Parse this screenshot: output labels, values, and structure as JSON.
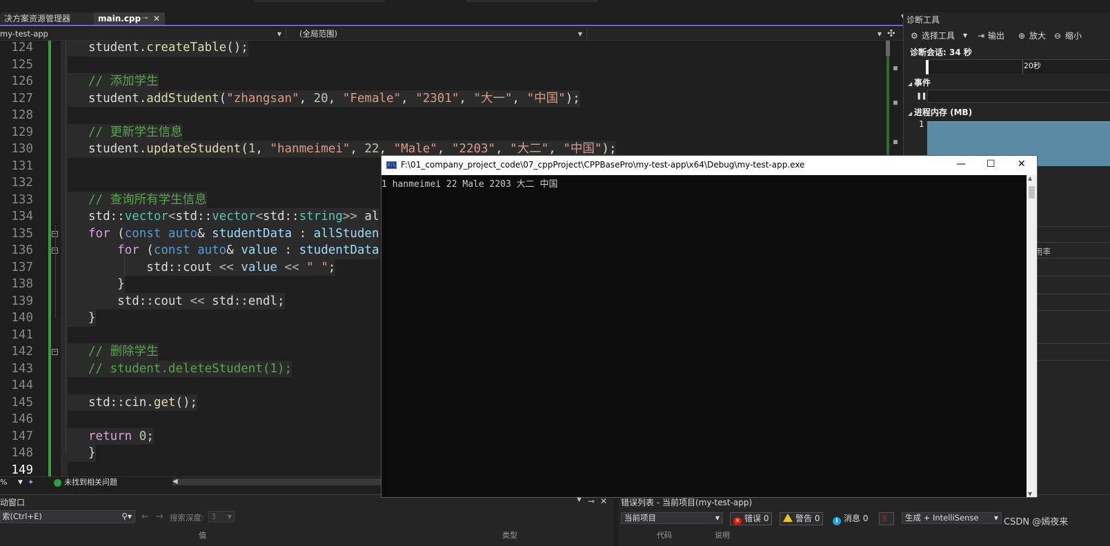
{
  "tabs": {
    "solution_explorer": "决方案资源管理器",
    "active_file": "main.cpp"
  },
  "nav": {
    "project": "my-test-app",
    "scope": "(全局范围)"
  },
  "editor": {
    "lines": [
      {
        "n": "124",
        "tokens": [
          [
            "c-id",
            "student."
          ],
          [
            "c-fn",
            "createTable"
          ],
          [
            "c-id",
            "();"
          ]
        ]
      },
      {
        "n": "125",
        "tokens": []
      },
      {
        "n": "126",
        "tokens": [
          [
            "c-cmt",
            "// 添加学生"
          ]
        ]
      },
      {
        "n": "127",
        "tokens": [
          [
            "c-id",
            "student."
          ],
          [
            "c-fn",
            "addStudent"
          ],
          [
            "c-id",
            "("
          ],
          [
            "c-str",
            "\"zhangsan\""
          ],
          [
            "c-id",
            ", "
          ],
          [
            "c-num",
            "20"
          ],
          [
            "c-id",
            ", "
          ],
          [
            "c-str",
            "\"Female\""
          ],
          [
            "c-id",
            ", "
          ],
          [
            "c-str",
            "\"2301\""
          ],
          [
            "c-id",
            ", "
          ],
          [
            "c-str",
            "\"大一\""
          ],
          [
            "c-id",
            ", "
          ],
          [
            "c-str",
            "\"中国\""
          ],
          [
            "c-id",
            ");"
          ]
        ]
      },
      {
        "n": "128",
        "tokens": []
      },
      {
        "n": "129",
        "tokens": [
          [
            "c-cmt",
            "// 更新学生信息"
          ]
        ]
      },
      {
        "n": "130",
        "tokens": [
          [
            "c-id",
            "student."
          ],
          [
            "c-fn",
            "updateStudent"
          ],
          [
            "c-id",
            "("
          ],
          [
            "c-num",
            "1"
          ],
          [
            "c-id",
            ", "
          ],
          [
            "c-str",
            "\"hanmeimei\""
          ],
          [
            "c-id",
            ", "
          ],
          [
            "c-num",
            "22"
          ],
          [
            "c-id",
            ", "
          ],
          [
            "c-str",
            "\"Male\""
          ],
          [
            "c-id",
            ", "
          ],
          [
            "c-str",
            "\"2203\""
          ],
          [
            "c-id",
            ", "
          ],
          [
            "c-str",
            "\"大二\""
          ],
          [
            "c-id",
            ", "
          ],
          [
            "c-str",
            "\"中国\""
          ],
          [
            "c-id",
            ");"
          ]
        ]
      },
      {
        "n": "131",
        "tokens": []
      },
      {
        "n": "132",
        "tokens": []
      },
      {
        "n": "133",
        "tokens": [
          [
            "c-cmt",
            "// 查询所有学生信息"
          ]
        ]
      },
      {
        "n": "134",
        "tokens": [
          [
            "c-id",
            "std::"
          ],
          [
            "c-ty",
            "vector"
          ],
          [
            "c-op",
            "<"
          ],
          [
            "c-id",
            "std::"
          ],
          [
            "c-ty",
            "vector"
          ],
          [
            "c-op",
            "<"
          ],
          [
            "c-id",
            "std::"
          ],
          [
            "c-ty",
            "string"
          ],
          [
            "c-op",
            "&gt;&gt;"
          ],
          [
            "c-id",
            " al"
          ]
        ]
      },
      {
        "n": "135",
        "tokens": [
          [
            "c-kw2",
            "for"
          ],
          [
            "c-id",
            " ("
          ],
          [
            "c-kw",
            "const"
          ],
          [
            "c-id",
            " "
          ],
          [
            "c-kw",
            "auto"
          ],
          [
            "c-id",
            "& "
          ],
          [
            "c-var",
            "studentData"
          ],
          [
            "c-id",
            " : "
          ],
          [
            "c-var",
            "allStuden"
          ]
        ]
      },
      {
        "n": "136",
        "tokens": [
          [
            "c-id",
            "    "
          ],
          [
            "c-kw2",
            "for"
          ],
          [
            "c-id",
            " ("
          ],
          [
            "c-kw",
            "const"
          ],
          [
            "c-id",
            " "
          ],
          [
            "c-kw",
            "auto"
          ],
          [
            "c-id",
            "& "
          ],
          [
            "c-var",
            "value"
          ],
          [
            "c-id",
            " : "
          ],
          [
            "c-var",
            "studentData"
          ]
        ]
      },
      {
        "n": "137",
        "tokens": [
          [
            "c-id",
            "        std::cout "
          ],
          [
            "c-op",
            "&lt;&lt;"
          ],
          [
            "c-id",
            " "
          ],
          [
            "c-var",
            "value"
          ],
          [
            "c-id",
            " "
          ],
          [
            "c-op",
            "&lt;&lt;"
          ],
          [
            "c-id",
            " "
          ],
          [
            "c-str",
            "\" \""
          ],
          [
            "c-id",
            ";"
          ]
        ]
      },
      {
        "n": "138",
        "tokens": [
          [
            "c-id",
            "    }"
          ]
        ]
      },
      {
        "n": "139",
        "tokens": [
          [
            "c-id",
            "    std::cout "
          ],
          [
            "c-op",
            "&lt;&lt;"
          ],
          [
            "c-id",
            " std::endl;"
          ]
        ]
      },
      {
        "n": "140",
        "tokens": [
          [
            "c-id",
            "}"
          ]
        ]
      },
      {
        "n": "141",
        "tokens": []
      },
      {
        "n": "142",
        "tokens": [
          [
            "c-cmt",
            "// 删除学生"
          ]
        ]
      },
      {
        "n": "143",
        "tokens": [
          [
            "c-cmt",
            "// student.deleteStudent(1);"
          ]
        ]
      },
      {
        "n": "144",
        "tokens": []
      },
      {
        "n": "145",
        "tokens": [
          [
            "c-id",
            "std::cin."
          ],
          [
            "c-fn",
            "get"
          ],
          [
            "c-id",
            "();"
          ]
        ]
      },
      {
        "n": "146",
        "tokens": []
      },
      {
        "n": "147",
        "tokens": [
          [
            "c-kw2",
            "return"
          ],
          [
            "c-id",
            " "
          ],
          [
            "c-num",
            "0"
          ],
          [
            "c-id",
            ";"
          ]
        ]
      },
      {
        "n": "148",
        "tokens": [
          [
            "c-id",
            "}"
          ]
        ]
      },
      {
        "n": "149",
        "tokens": []
      }
    ]
  },
  "status": {
    "zoom": "%",
    "issues": "未找到相关问题"
  },
  "bottom_left": {
    "title": "动窗口",
    "search": "索(Ctrl+E)",
    "depth_label": "搜索深度:",
    "depth_value": "3",
    "col_value": "值",
    "col_type": "类型"
  },
  "bottom_right": {
    "title": "错误列表 - 当前项目(my-test-app)",
    "scope": "当前项目",
    "errors": "错误 0",
    "warnings": "警告 0",
    "messages": "消息 0",
    "build": "生成 + IntelliSense",
    "col_code": "代码",
    "col_desc": "说明"
  },
  "watermark": "CSDN @嫣夜来",
  "diagnostics": {
    "title": "诊断工具",
    "select_tool": "选择工具",
    "output": "输出",
    "zoom_in": "放大",
    "zoom_out": "缩小",
    "session": "诊断会话: 34 秒",
    "timeline_label": "20秒",
    "events": "事件",
    "memory": "进程内存 (MB)",
    "memory_value": "1",
    "cpu_tab": "用率"
  },
  "console": {
    "title": "F:\\01_company_project_code\\07_cppProject\\CPPBasePro\\my-test-app\\x64\\Debug\\my-test-app.exe",
    "output": "1 hanmeimei 22 Male 2203 大二 中国"
  }
}
